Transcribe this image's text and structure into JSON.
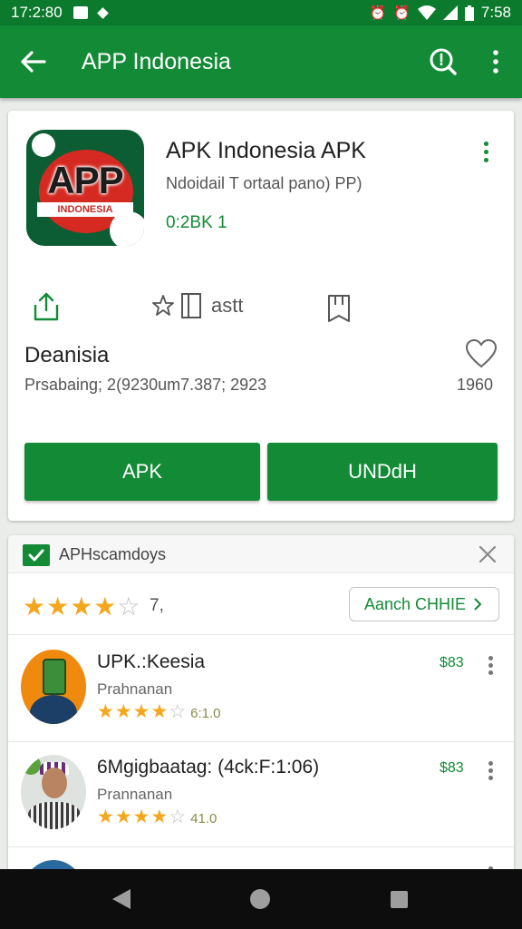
{
  "status_bar": {
    "time_left": "17:2:80",
    "time_right": "7:58"
  },
  "app_bar": {
    "title": "APP Indonesia"
  },
  "app": {
    "name": "APK Indonesia APK",
    "developer": "Ndoidail T ortaal pano) PP)",
    "meta": "0:2BK 1",
    "icon_text": "APP",
    "icon_subtext": "INDONESIA"
  },
  "actions": {
    "mid_label": "astt"
  },
  "section": {
    "title": "Deanisia",
    "subtitle": "Prsabaing; 2(9230um7.387; 2923",
    "like_count": "1960"
  },
  "buttons": {
    "apk": "APK",
    "unduh": "UNDdH"
  },
  "list": {
    "header": "APHscamdoys",
    "rating_value": "7,",
    "more_button": "Aanch CHHIE",
    "items": [
      {
        "name": "UPK.:Keesia",
        "subtitle": "Prahnanan",
        "rating": "6:1.0",
        "price": "$83"
      },
      {
        "name": "6Mgigbaatag: (4ck:F:1:06)",
        "subtitle": "Prannanan",
        "rating": "41.0",
        "price": "$83"
      }
    ]
  },
  "colors": {
    "primary": "#138a36",
    "status_bar": "#0b7a2c",
    "star": "#f4a61f"
  }
}
